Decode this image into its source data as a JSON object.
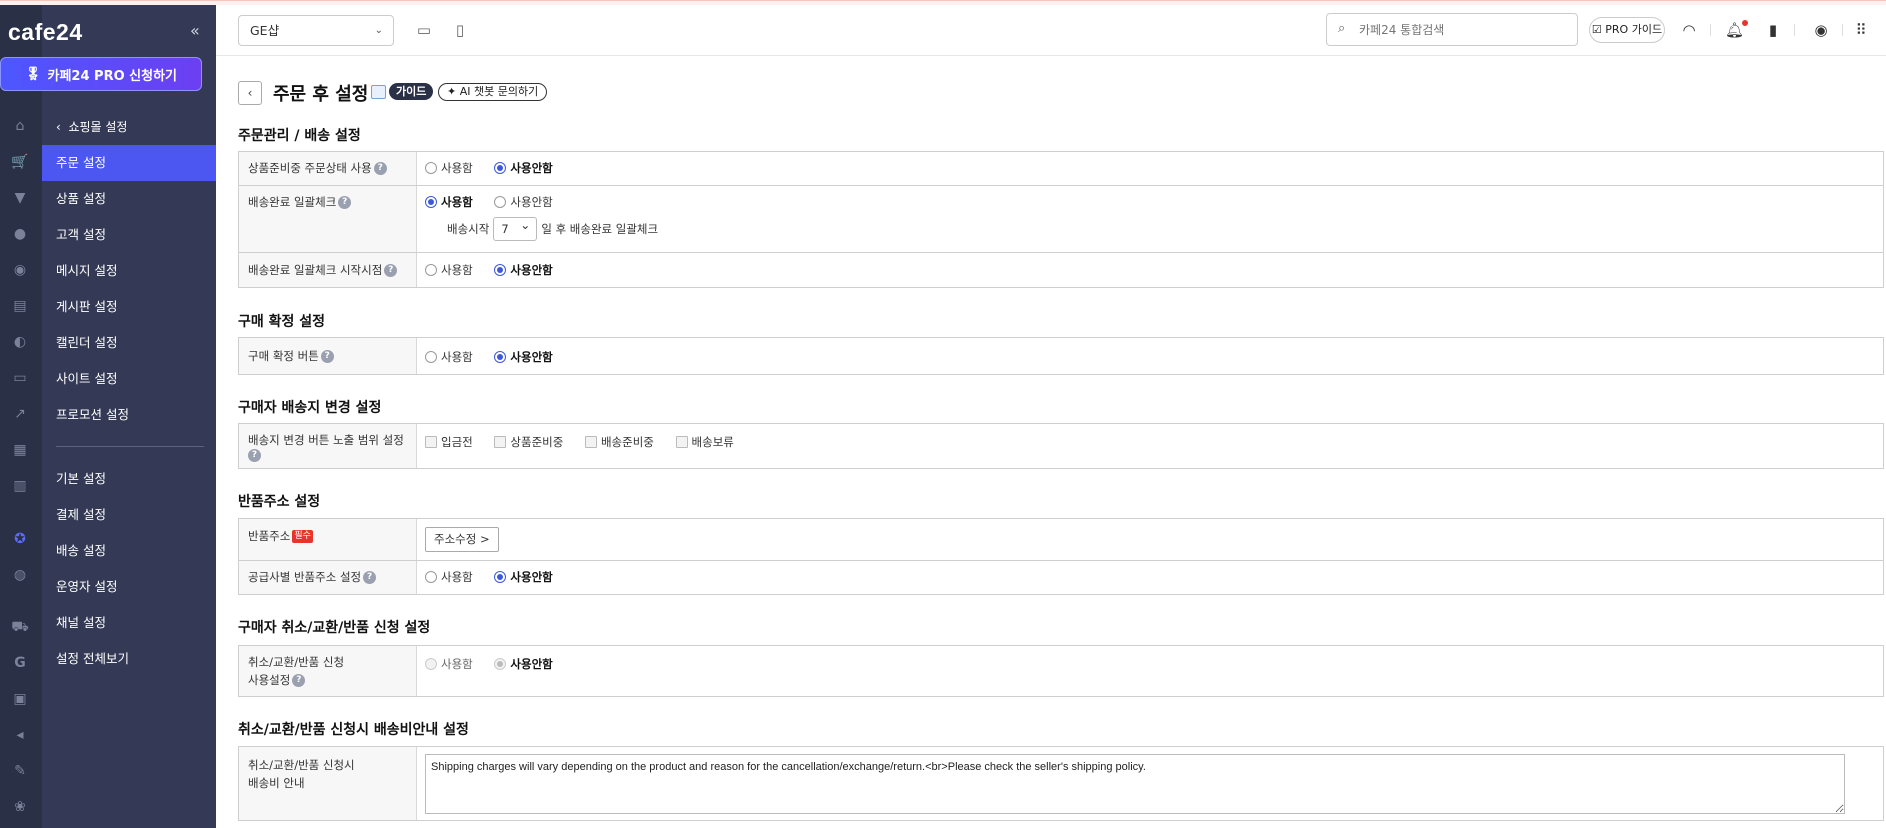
{
  "app": {
    "logo": "cafe24",
    "collapse_icon": "«",
    "pro_button": "카페24 PRO 신청하기"
  },
  "sidebar": {
    "back_label": "쇼핑몰 설정",
    "group1": [
      {
        "label": "주문 설정",
        "active": true
      },
      {
        "label": "상품 설정"
      },
      {
        "label": "고객 설정"
      },
      {
        "label": "메시지 설정"
      },
      {
        "label": "게시판 설정"
      },
      {
        "label": "캘린더 설정"
      },
      {
        "label": "사이트 설정"
      },
      {
        "label": "프로모션 설정"
      }
    ],
    "group2": [
      {
        "label": "기본 설정"
      },
      {
        "label": "결제 설정"
      },
      {
        "label": "배송 설정"
      },
      {
        "label": "운영자 설정"
      },
      {
        "label": "채널 설정"
      },
      {
        "label": "설정 전체보기"
      }
    ]
  },
  "topbar": {
    "shop_select": "GE샵",
    "search_placeholder": "카페24 통합검색",
    "pro_guide": "PRO 가이드"
  },
  "page": {
    "title": "주문 후 설정",
    "guide_badge": "가이드",
    "ai_button": "AI 챗봇 문의하기"
  },
  "opts": {
    "use": "사용함",
    "nouse": "사용안함"
  },
  "sections": {
    "s1": {
      "title": "주문관리 / 배송 설정",
      "r1": "상품준비중 주문상태 사용",
      "r2": "배송완료 일괄체크",
      "r2_pre": "배송시작",
      "r2_days": "7",
      "r2_post": "일 후 배송완료 일괄체크",
      "r3": "배송완료 일괄체크 시작시점"
    },
    "s2": {
      "title": "구매 확정 설정",
      "r1": "구매 확정 버튼"
    },
    "s3": {
      "title": "구매자 배송지 변경 설정",
      "r1": "배송지 변경 버튼 노출 범위 설정",
      "checks": [
        "입금전",
        "상품준비중",
        "배송준비중",
        "배송보류"
      ]
    },
    "s4": {
      "title": "반품주소 설정",
      "r1": "반품주소",
      "req": "필수",
      "addr_btn": "주소수정 >",
      "r2": "공급사별 반품주소 설정"
    },
    "s5": {
      "title": "구매자 취소/교환/반품 신청 설정",
      "r1a": "취소/교환/반품 신청",
      "r1b": "사용설정"
    },
    "s6": {
      "title": "취소/교환/반품 신청시 배송비안내 설정",
      "r1a": "취소/교환/반품 신청시",
      "r1b": "배송비 안내",
      "text": "Shipping charges will vary depending on the product and reason for the cancellation/exchange/return.<br>Please check the seller's shipping policy."
    }
  },
  "colors": {
    "sidebar": "#343a55",
    "rail": "#2a3046",
    "accent": "#4b57f0",
    "radio": "#3d58d8"
  },
  "icons": [
    "home-icon",
    "cart-icon",
    "shirt-icon",
    "user-icon",
    "chat-icon",
    "board-icon",
    "palette-icon",
    "ticket-icon",
    "chart-icon",
    "grid-icon",
    "book-icon",
    "award-icon",
    "globe-icon",
    "truck-icon",
    "google-icon",
    "store-icon",
    "megaphone-icon",
    "pen-icon",
    "fan-icon"
  ]
}
